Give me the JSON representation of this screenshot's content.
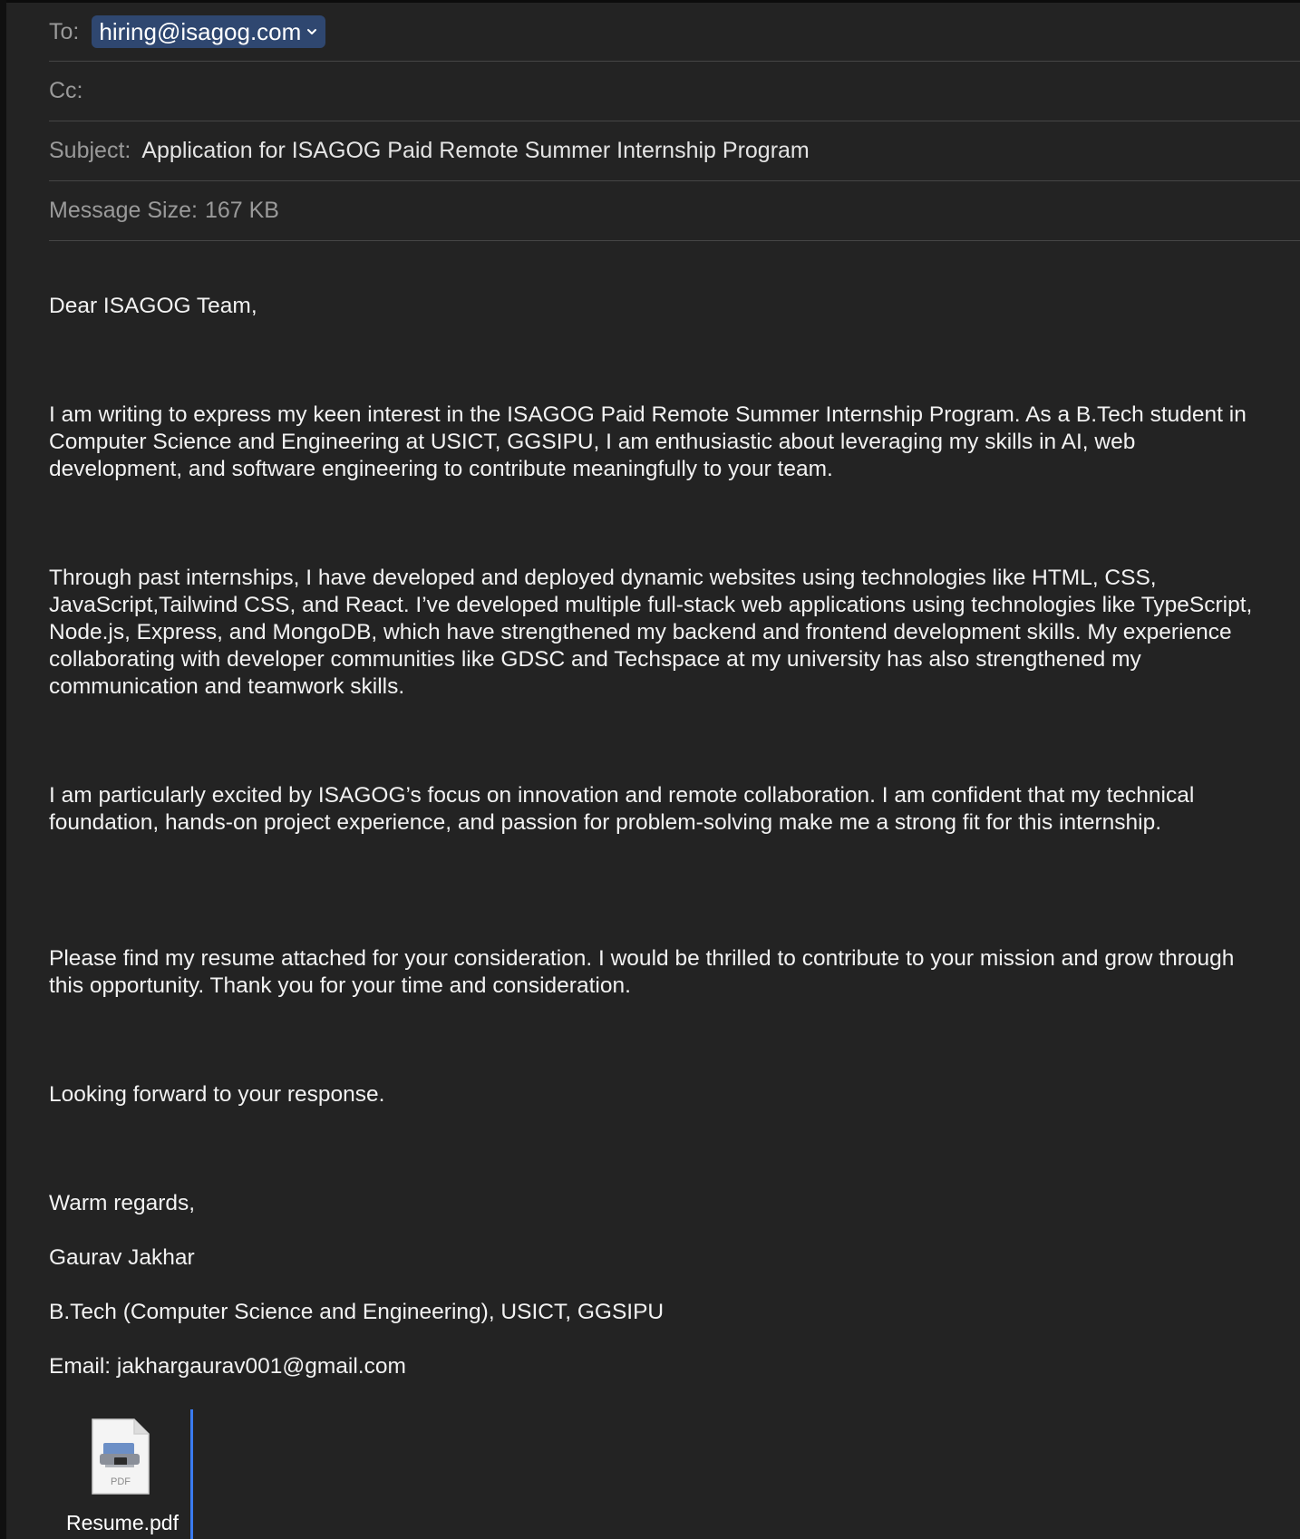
{
  "header": {
    "to_label": "To:",
    "to_recipient": "hiring@isagog.com",
    "cc_label": "Cc:",
    "subject_label": "Subject:",
    "subject_value": "Application for ISAGOG Paid Remote Summer Internship Program",
    "message_size_label": "Message Size:",
    "message_size_value": "167 KB"
  },
  "body": {
    "greeting": "Dear ISAGOG Team,",
    "paragraphs": [
      "I am writing to express my keen interest in the ISAGOG Paid Remote Summer Internship Program. As a B.Tech student in Computer Science and Engineering at USICT, GGSIPU, I am enthusiastic about leveraging my skills in AI, web development, and software engineering to contribute meaningfully to your team.",
      "Through past internships, I have developed and deployed dynamic websites using technologies like HTML, CSS, JavaScript,Tailwind CSS, and React. I’ve developed multiple full-stack web applications using technologies like TypeScript, Node.js, Express, and MongoDB, which have strengthened my backend and frontend development skills. My experience collaborating with developer communities like GDSC and Techspace at my university has also strengthened my communication and teamwork skills.",
      "I am particularly excited by ISAGOG’s focus on innovation and remote collaboration. I am confident that my technical foundation, hands-on project experience, and passion for problem-solving make me a strong fit for this internship.",
      "Please find my resume attached for your consideration. I would be thrilled to contribute to your mission and grow through this opportunity. Thank you for your time and consideration."
    ],
    "closing": "Looking forward to your response.",
    "signoff": "Warm regards,",
    "name": "Gaurav Jakhar",
    "degree": "B.Tech (Computer Science and Engineering), USICT, GGSIPU",
    "email": "Email: jakhargaurav001@gmail.com"
  },
  "attachment": {
    "file_name": "Resume.pdf",
    "icon": "pdf-document-icon",
    "icon_badge": "PDF"
  },
  "colors": {
    "background": "#232323",
    "recipient_chip": "#2f4770",
    "caret": "#3a7bf0"
  }
}
